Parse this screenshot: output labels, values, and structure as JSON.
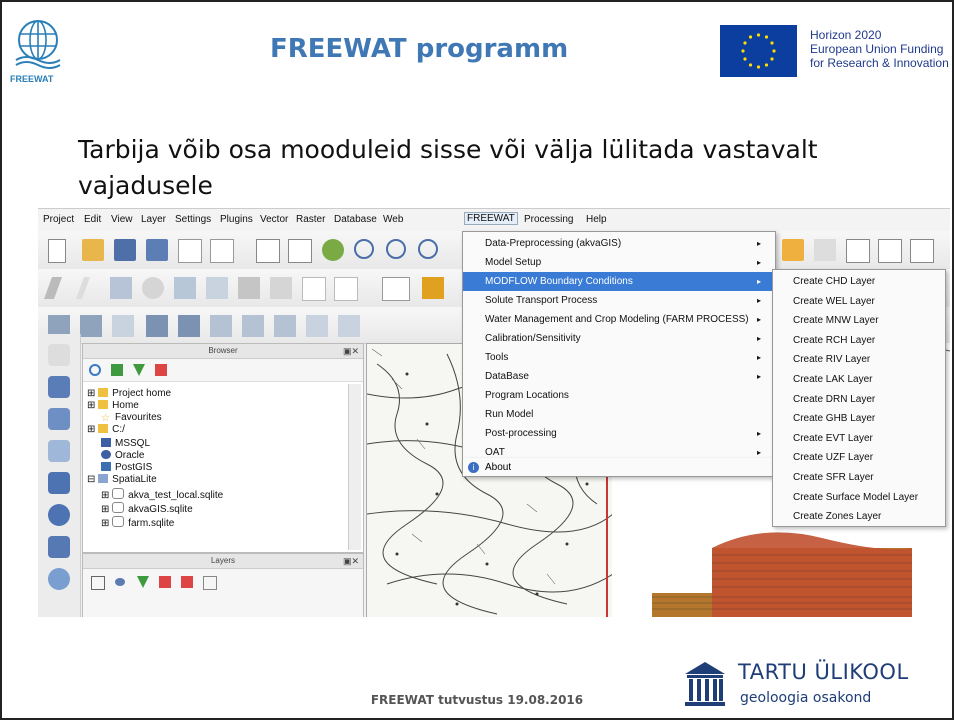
{
  "header": {
    "logo_text": "FREEWAT",
    "title": "FREEWAT programm",
    "eu_text": [
      "Horizon 2020",
      "European Union Funding",
      "for Research & Innovation"
    ]
  },
  "subtitle": "Tarbija võib osa mooduleid sisse või välja lülitada vastavalt vajadusele",
  "app": {
    "menubar": [
      "Project",
      "Edit",
      "View",
      "Layer",
      "Settings",
      "Plugins",
      "Vector",
      "Raster",
      "Database",
      "Web",
      "FREEWAT",
      "Processing",
      "Help"
    ],
    "active_menu": "FREEWAT",
    "freewat_menu": [
      {
        "label": "Data-Preprocessing (akvaGIS)",
        "submenu": true
      },
      {
        "label": "Model Setup",
        "submenu": true
      },
      {
        "label": "MODFLOW Boundary Conditions",
        "submenu": true,
        "highlighted": true
      },
      {
        "label": "Solute Transport Process",
        "submenu": true
      },
      {
        "label": "Water Management and Crop Modeling (FARM PROCESS)",
        "submenu": true
      },
      {
        "label": "Calibration/Sensitivity",
        "submenu": true
      },
      {
        "label": "Tools",
        "submenu": true
      },
      {
        "label": "DataBase",
        "submenu": true
      },
      {
        "label": "Program Locations",
        "submenu": false
      },
      {
        "label": "Run Model",
        "submenu": false
      },
      {
        "label": "Post-processing",
        "submenu": true
      },
      {
        "label": "OAT",
        "submenu": true
      },
      {
        "label": "About",
        "submenu": false
      }
    ],
    "boundary_submenu": [
      "Create CHD Layer",
      "Create WEL Layer",
      "Create MNW Layer",
      "Create RCH Layer",
      "Create RIV Layer",
      "Create LAK Layer",
      "Create DRN Layer",
      "Create GHB Layer",
      "Create EVT Layer",
      "Create UZF Layer",
      "Create SFR Layer",
      "Create Surface Model Layer",
      "Create Zones Layer"
    ],
    "browser": {
      "title": "Browser",
      "items": [
        "Project home",
        "Home",
        "Favourites",
        "C:/",
        "MSSQL",
        "Oracle",
        "PostGIS",
        "SpatiaLite",
        "akva_test_local.sqlite",
        "akvaGIS.sqlite",
        "farm.sqlite"
      ]
    },
    "layers": {
      "title": "Layers"
    }
  },
  "footer": {
    "text": "FREEWAT tutvustus  19.08.2016",
    "uni_name": "TARTU ÜLIKOOL",
    "uni_sub": "geoloogia osakond"
  }
}
